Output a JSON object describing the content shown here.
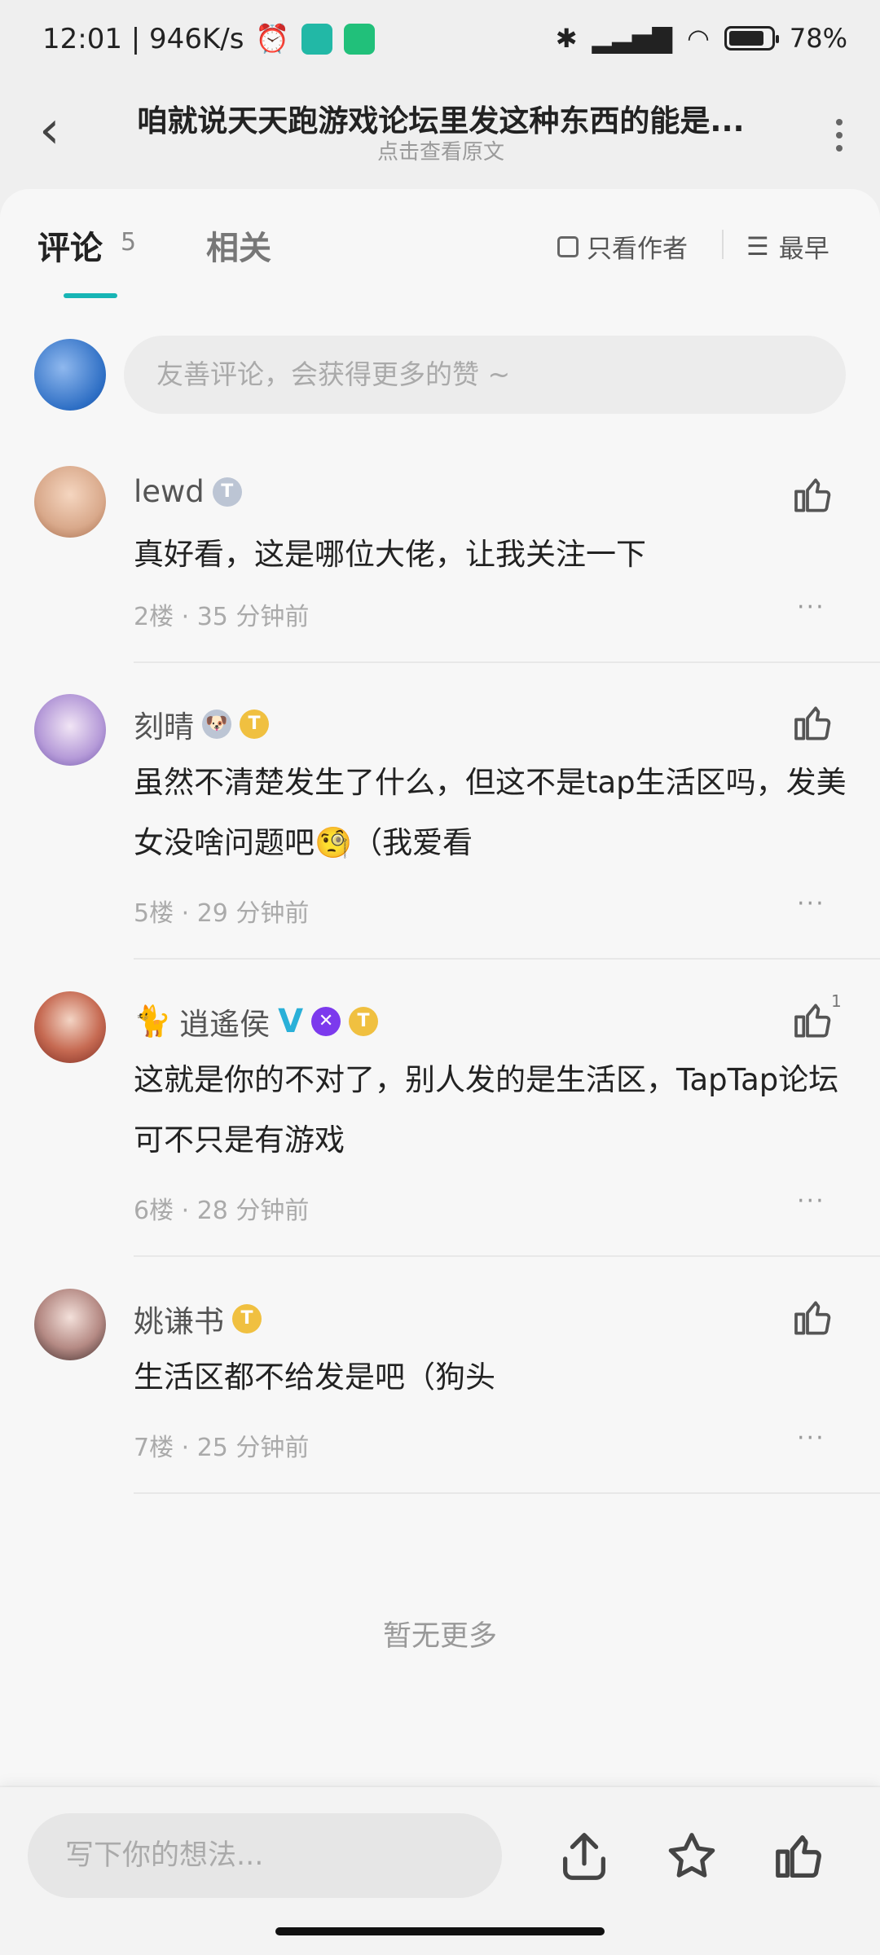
{
  "status": {
    "time_speed": "12:01 | 946K/s",
    "battery": "78%",
    "battery_level": 0.78
  },
  "header": {
    "title": "咱就说天天跑游戏论坛里发这种东西的能是...",
    "subtitle": "点击查看原文"
  },
  "tabs": {
    "comments": "评论",
    "comment_count": "5",
    "related": "相关",
    "author_only": "只看作者",
    "sort": "最早"
  },
  "composer": {
    "placeholder": "友善评论，会获得更多的赞 ~"
  },
  "comments": [
    {
      "user": "lewd",
      "text": "真好看，这是哪位大佬，让我关注一下",
      "floor": "2楼",
      "time": "35 分钟前",
      "likes": ""
    },
    {
      "user": "刻晴",
      "text": "虽然不清楚发生了什么，但这不是tap生活区吗，发美女没啥问题吧🧐（我爱看",
      "floor": "5楼",
      "time": "29 分钟前",
      "likes": ""
    },
    {
      "user": "逍遙侯",
      "text": "这就是你的不对了，别人发的是生活区，TapTap论坛可不只是有游戏",
      "floor": "6楼",
      "time": "28 分钟前",
      "likes": "1"
    },
    {
      "user": "姚谦书",
      "text": "生活区都不给发是吧（狗头",
      "floor": "7楼",
      "time": "25 分钟前",
      "likes": ""
    }
  ],
  "footer": {
    "no_more": "暂无更多"
  },
  "bottom": {
    "placeholder": "写下你的想法..."
  },
  "colors": {
    "accent": "#17b5b5",
    "badge_gold": "#f0c040"
  }
}
